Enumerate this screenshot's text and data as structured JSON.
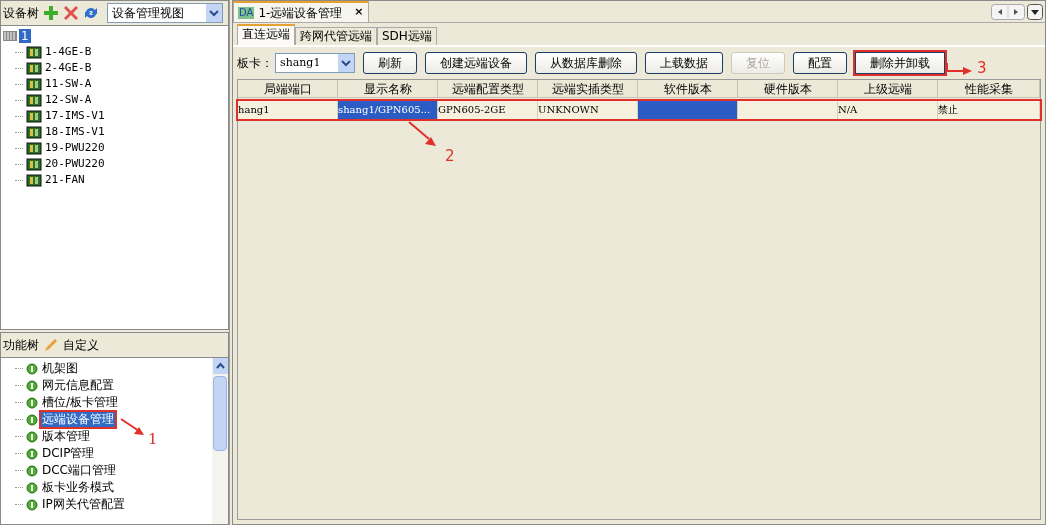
{
  "device_tree": {
    "title": "设备树",
    "view_select": "设备管理视图",
    "root": {
      "label": "1",
      "selected": true,
      "children": [
        {
          "label": "1-4GE-B"
        },
        {
          "label": "2-4GE-B"
        },
        {
          "label": "11-SW-A"
        },
        {
          "label": "12-SW-A"
        },
        {
          "label": "17-IMS-V1"
        },
        {
          "label": "18-IMS-V1"
        },
        {
          "label": "19-PWU220"
        },
        {
          "label": "20-PWU220"
        },
        {
          "label": "21-FAN"
        }
      ]
    }
  },
  "function_tree": {
    "title": "功能树",
    "customize": "自定义",
    "items": [
      {
        "label": "机架图",
        "selected": false,
        "highlighted": false
      },
      {
        "label": "网元信息配置",
        "selected": false,
        "highlighted": false
      },
      {
        "label": "槽位/板卡管理",
        "selected": false,
        "highlighted": false
      },
      {
        "label": "远端设备管理",
        "selected": true,
        "highlighted": true
      },
      {
        "label": "版本管理",
        "selected": false,
        "highlighted": false
      },
      {
        "label": "DCIP管理",
        "selected": false,
        "highlighted": false
      },
      {
        "label": "DCC端口管理",
        "selected": false,
        "highlighted": false
      },
      {
        "label": "板卡业务模式",
        "selected": false,
        "highlighted": false
      },
      {
        "label": "IP网关代管配置",
        "selected": false,
        "highlighted": false
      }
    ]
  },
  "document_tab": {
    "icon_text": "DA",
    "label": "1-远端设备管理",
    "close": "×"
  },
  "sub_tabs": [
    {
      "label": "直连远端",
      "selected": true
    },
    {
      "label": "跨网代管远端",
      "selected": false
    },
    {
      "label": "SDH远端",
      "selected": false
    }
  ],
  "toolbar": {
    "board_label": "板卡：",
    "board_value": "shang1",
    "buttons": [
      {
        "label": "刷新",
        "disabled": false,
        "highlighted": false
      },
      {
        "label": "创建远端设备",
        "disabled": false,
        "highlighted": false
      },
      {
        "label": "从数据库删除",
        "disabled": false,
        "highlighted": false
      },
      {
        "label": "上载数据",
        "disabled": false,
        "highlighted": false
      },
      {
        "label": "复位",
        "disabled": true,
        "highlighted": false
      },
      {
        "label": "配置",
        "disabled": false,
        "highlighted": false
      },
      {
        "label": "删除并卸载",
        "disabled": false,
        "highlighted": true
      }
    ]
  },
  "table": {
    "columns": [
      "局端端口",
      "显示名称",
      "远端配置类型",
      "远端实插类型",
      "软件版本",
      "硬件版本",
      "上级远端",
      "性能采集"
    ],
    "rows": [
      {
        "highlighted": true,
        "cells": [
          {
            "text": "hang1",
            "selected": false
          },
          {
            "text": "shang1/GPN605...",
            "selected": true
          },
          {
            "text": "GPN605-2GE",
            "selected": false
          },
          {
            "text": "UNKNOWN",
            "selected": false
          },
          {
            "text": "",
            "selected": true
          },
          {
            "text": "",
            "selected": false
          },
          {
            "text": "N/A",
            "selected": false
          },
          {
            "text": "禁止",
            "selected": false
          }
        ]
      }
    ]
  },
  "callouts": [
    {
      "label": "1"
    },
    {
      "label": "2"
    },
    {
      "label": "3"
    }
  ]
}
